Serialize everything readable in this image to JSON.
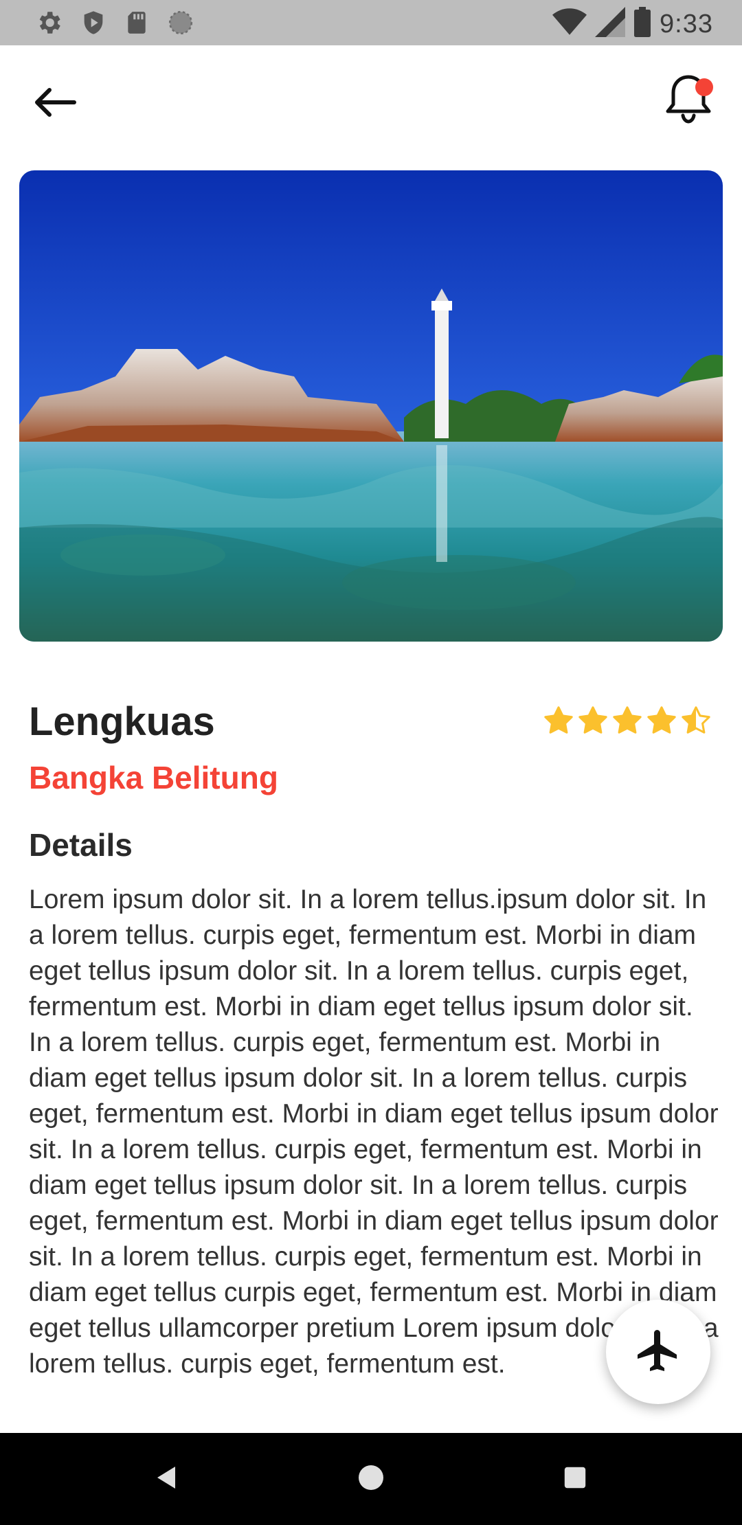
{
  "status_bar": {
    "time": "9:33",
    "left_icons": [
      "gear-icon",
      "shield-icon",
      "sd-card-icon",
      "circle-icon"
    ],
    "right_icons": [
      "wifi-icon",
      "signal-icon",
      "battery-icon"
    ]
  },
  "topbar": {
    "back_icon": "arrow-left-icon",
    "notification_icon": "bell-icon",
    "notification_dot_color": "#f44336"
  },
  "place": {
    "name": "Lengkuas",
    "location": "Bangka Belitung",
    "rating": 4.5,
    "rating_max": 5
  },
  "details": {
    "heading": "Details",
    "body": "Lorem ipsum dolor sit. In a lorem tellus.ipsum dolor sit. In a lorem tellus. curpis eget, fermentum est. Morbi in diam eget tellus  ipsum dolor sit. In a lorem tellus. curpis eget, fermentum est. Morbi in diam eget tellus ipsum dolor sit. In a lorem tellus. curpis eget, fermentum est. Morbi in diam eget tellus ipsum dolor sit. In a lorem tellus. curpis eget, fermentum est. Morbi in diam eget tellus ipsum dolor sit. In a lorem tellus. curpis eget, fermentum est. Morbi in diam eget tellus ipsum dolor sit. In a lorem tellus. curpis eget, fermentum est. Morbi in diam eget tellus ipsum dolor sit. In a lorem tellus. curpis eget, fermentum est. Morbi in diam eget tellus curpis eget, fermentum est. Morbi in diam eget tellus ullamcorper pretium Lorem ipsum dolor sit. In a lorem tellus. curpis eget, fermentum est."
  },
  "fab": {
    "icon": "airplane-icon"
  },
  "nav_bar": {
    "icons": [
      "back-triangle-icon",
      "home-circle-icon",
      "recents-square-icon"
    ]
  },
  "colors": {
    "accent": "#f44336",
    "star": "#fbc02d",
    "title": "#222222"
  }
}
